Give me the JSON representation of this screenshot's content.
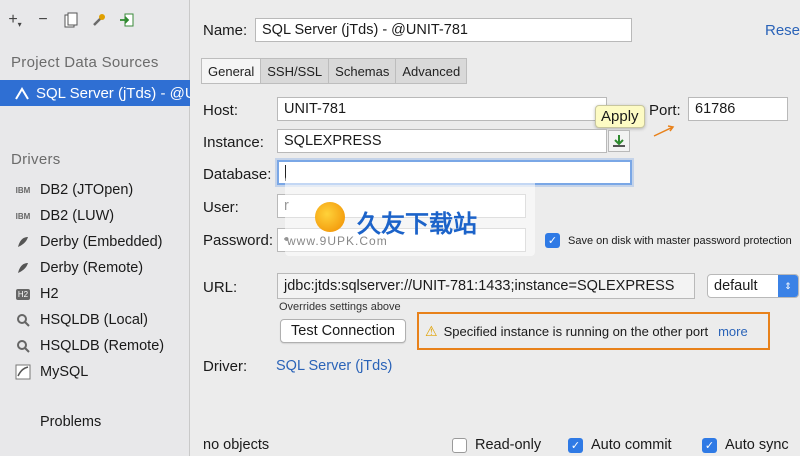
{
  "toolbar": {
    "add_icon": "plus-icon",
    "remove_icon": "minus-icon",
    "duplicate_icon": "duplicate-icon",
    "properties_icon": "wrench-icon",
    "import_icon": "import-icon"
  },
  "sidebar": {
    "project_section": "Project Data Sources",
    "selected_source": "SQL Server (jTds) - @U",
    "drivers_section": "Drivers",
    "drivers": [
      {
        "label": "DB2 (JTOpen)",
        "icon": "IBM"
      },
      {
        "label": "DB2 (LUW)",
        "icon": "IBM"
      },
      {
        "label": "Derby (Embedded)",
        "icon": "feather-icon"
      },
      {
        "label": "Derby (Remote)",
        "icon": "feather-icon"
      },
      {
        "label": "H2",
        "icon": "H2"
      },
      {
        "label": "HSQLDB (Local)",
        "icon": "hsqldb-icon"
      },
      {
        "label": "HSQLDB (Remote)",
        "icon": "hsqldb-icon"
      },
      {
        "label": "MySQL",
        "icon": "mysql-icon"
      }
    ],
    "problems": "Problems"
  },
  "main": {
    "name_label": "Name:",
    "name_value": "SQL Server (jTds) - @UNIT-781",
    "reset": "Reset",
    "tabs": [
      "General",
      "SSH/SSL",
      "Schemas",
      "Advanced"
    ],
    "host_label": "Host:",
    "host_value": "UNIT-781",
    "apply_tooltip": "Apply",
    "port_label": "Port:",
    "port_value": "61786",
    "instance_label": "Instance:",
    "instance_value": "SQLEXPRESS",
    "database_label": "Database:",
    "database_value": "",
    "user_label": "User:",
    "user_value": "r",
    "password_label": "Password:",
    "password_value": "•",
    "save_password_label": "Save on disk with master password protection",
    "url_label": "URL:",
    "url_value": "jdbc:jtds:sqlserver://UNIT-781:1433;instance=SQLEXPRESS",
    "url_mode": "default",
    "overrides_note": "Overrides settings above",
    "test_connection": "Test Connection",
    "warning_text": "Specified instance is running on the other port",
    "warning_more": "more",
    "driver_label": "Driver:",
    "driver_value": "SQL Server (jTds)",
    "status": "no objects",
    "read_only": "Read-only",
    "auto_commit": "Auto commit",
    "auto_sync": "Auto sync"
  },
  "watermark": {
    "brand": "久友下载站",
    "url": "www.9UPK.Com"
  },
  "colors": {
    "selection": "#2f6fd3",
    "accent_checkbox": "#2f7ae5",
    "warning_border": "#e8811a",
    "link": "#2a63b8"
  }
}
